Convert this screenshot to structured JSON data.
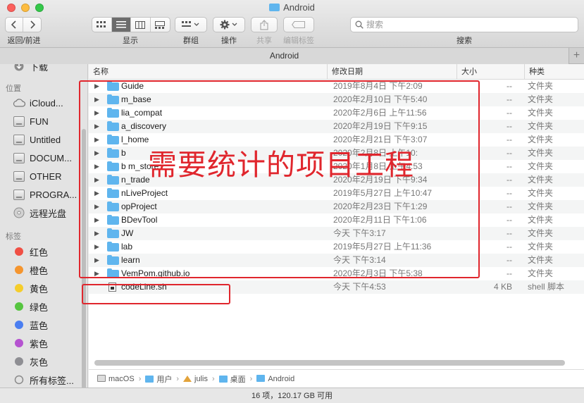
{
  "window": {
    "title": "Android"
  },
  "toolbar": {
    "nav_label": "返回/前进",
    "view_label": "显示",
    "group_label": "群组",
    "action_label": "操作",
    "share_label": "共享",
    "edit_tags_label": "编辑标签",
    "search_label": "搜索",
    "search_placeholder": "搜索"
  },
  "tabbar": {
    "tab": "Android",
    "plus": "+"
  },
  "sidebar": {
    "partial_item": "下载",
    "locations_header": "位置",
    "locations": [
      {
        "label": "iCloud...",
        "icon": "cloud-icon"
      },
      {
        "label": "FUN",
        "icon": "disk-icon"
      },
      {
        "label": "Untitled",
        "icon": "disk-icon"
      },
      {
        "label": "DOCUM...",
        "icon": "disk-icon"
      },
      {
        "label": "OTHER",
        "icon": "disk-icon"
      },
      {
        "label": "PROGRA...",
        "icon": "disk-icon"
      },
      {
        "label": "远程光盘",
        "icon": "optical-disc-icon"
      }
    ],
    "tags_header": "标签",
    "tags": [
      {
        "label": "红色",
        "color": "#f04f44"
      },
      {
        "label": "橙色",
        "color": "#f5952e"
      },
      {
        "label": "黄色",
        "color": "#f5cd2b"
      },
      {
        "label": "绿色",
        "color": "#56c540"
      },
      {
        "label": "蓝色",
        "color": "#4a7ef1"
      },
      {
        "label": "紫色",
        "color": "#b553d0"
      },
      {
        "label": "灰色",
        "color": "#8e8e93"
      },
      {
        "label": "所有标签...",
        "color": ""
      }
    ]
  },
  "columns": {
    "name": "名称",
    "date": "修改日期",
    "size": "大小",
    "kind": "种类"
  },
  "files": [
    {
      "name": "Guide",
      "date": "2019年8月4日 下午2:09",
      "size": "--",
      "kind": "文件夹",
      "type": "folder"
    },
    {
      "name": "m_base",
      "date": "2020年2月10日 下午5:40",
      "size": "--",
      "kind": "文件夹",
      "type": "folder"
    },
    {
      "name": "lia_compat",
      "date": "2020年2月6日 上午11:56",
      "size": "--",
      "kind": "文件夹",
      "type": "folder"
    },
    {
      "name": "a_discovery",
      "date": "2020年2月19日 下午9:15",
      "size": "--",
      "kind": "文件夹",
      "type": "folder"
    },
    {
      "name": "l_home",
      "date": "2020年2月21日 下午3:07",
      "size": "--",
      "kind": "文件夹",
      "type": "folder"
    },
    {
      "name": "b",
      "date": "2020年2月8日 上午10:",
      "size": "--",
      "kind": "文件夹",
      "type": "folder"
    },
    {
      "name": "b m_store",
      "date": "2020年1月8日 上午4:53",
      "size": "--",
      "kind": "文件夹",
      "type": "folder"
    },
    {
      "name": "n_trade",
      "date": "2020年2月19日 下午9:34",
      "size": "--",
      "kind": "文件夹",
      "type": "folder"
    },
    {
      "name": "nLiveProject",
      "date": "2019年5月27日 上午10:47",
      "size": "--",
      "kind": "文件夹",
      "type": "folder"
    },
    {
      "name": "opProject",
      "date": "2020年2月23日 下午1:29",
      "size": "--",
      "kind": "文件夹",
      "type": "folder"
    },
    {
      "name": "BDevTool",
      "date": "2020年2月11日 下午1:06",
      "size": "--",
      "kind": "文件夹",
      "type": "folder"
    },
    {
      "name": "JW",
      "date": "今天 下午3:17",
      "size": "--",
      "kind": "文件夹",
      "type": "folder"
    },
    {
      "name": "lab",
      "date": "2019年5月27日 上午11:36",
      "size": "--",
      "kind": "文件夹",
      "type": "folder"
    },
    {
      "name": "learn",
      "date": "今天 下午3:14",
      "size": "--",
      "kind": "文件夹",
      "type": "folder"
    },
    {
      "name": "VemPom.github.io",
      "date": "2020年2月3日 下午5:38",
      "size": "--",
      "kind": "文件夹",
      "type": "folder"
    },
    {
      "name": "codeLine.sh",
      "date": "今天 下午4:53",
      "size": "4 KB",
      "kind": "shell 脚本",
      "type": "file"
    }
  ],
  "pathbar": [
    "macOS",
    "用户",
    "julis",
    "桌面",
    "Android"
  ],
  "status": "16 项，120.17 GB 可用",
  "annotation": {
    "text": "需要统计的项目工程",
    "color": "#e0262d"
  }
}
